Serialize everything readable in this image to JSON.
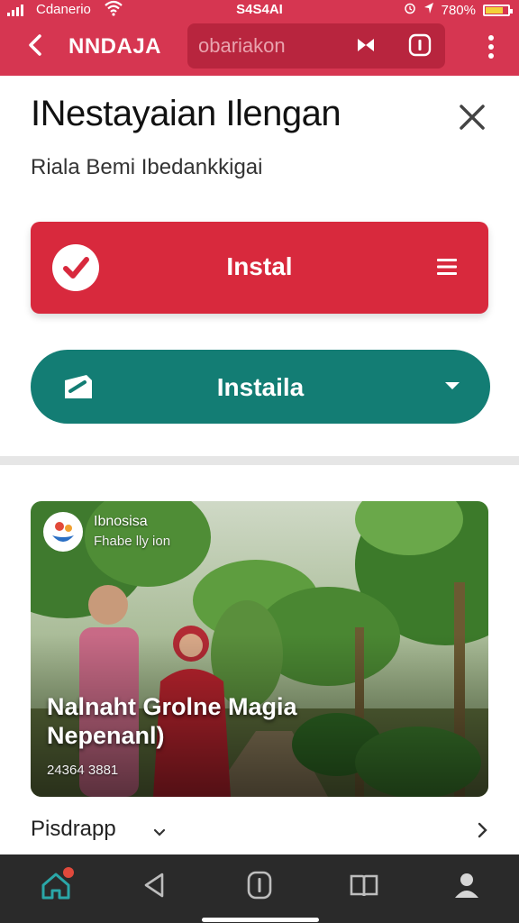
{
  "status_bar": {
    "carrier": "Cdanerio",
    "time": "S4S4AI",
    "battery": "780%",
    "battery_level": 0.8,
    "icons": [
      "signal-icon",
      "wifi-icon",
      "alarm-icon",
      "location-icon",
      "battery-icon"
    ]
  },
  "app_bar": {
    "title": "NNDAJA",
    "search_placeholder": "obariakon",
    "icons": [
      "back-icon",
      "clear-icon",
      "info-icon",
      "more-icon"
    ]
  },
  "sheet": {
    "title": "INestayaian Ilengan",
    "subtitle": "Riala Bemi Ibedankkigai"
  },
  "primary_button": {
    "label": "Instal",
    "icons": [
      "check-circle-icon",
      "menu-icon"
    ]
  },
  "secondary_button": {
    "label": "Instaila",
    "icons": [
      "tag-icon",
      "caret-down-icon"
    ]
  },
  "card": {
    "source_name": "Ibnosisa",
    "source_sub": "Fhabe lly ion",
    "caption": "Nalnaht Grolne Magia Nepenanl)",
    "meta": "24364 3881",
    "image": "photo of two people among banana trees in a garden"
  },
  "footer": {
    "label": "Pisdrapp",
    "icons": [
      "chevron-down-icon",
      "chevron-right-icon"
    ]
  },
  "bottom_nav": {
    "tabs": [
      "home-icon",
      "back-triangle-icon",
      "info-pill-icon",
      "book-icon",
      "profile-icon"
    ]
  },
  "colors": {
    "brand_red": "#d63651",
    "button_red": "#d8293d",
    "teal": "#137d74",
    "nav_dark": "#2a2a2a"
  }
}
